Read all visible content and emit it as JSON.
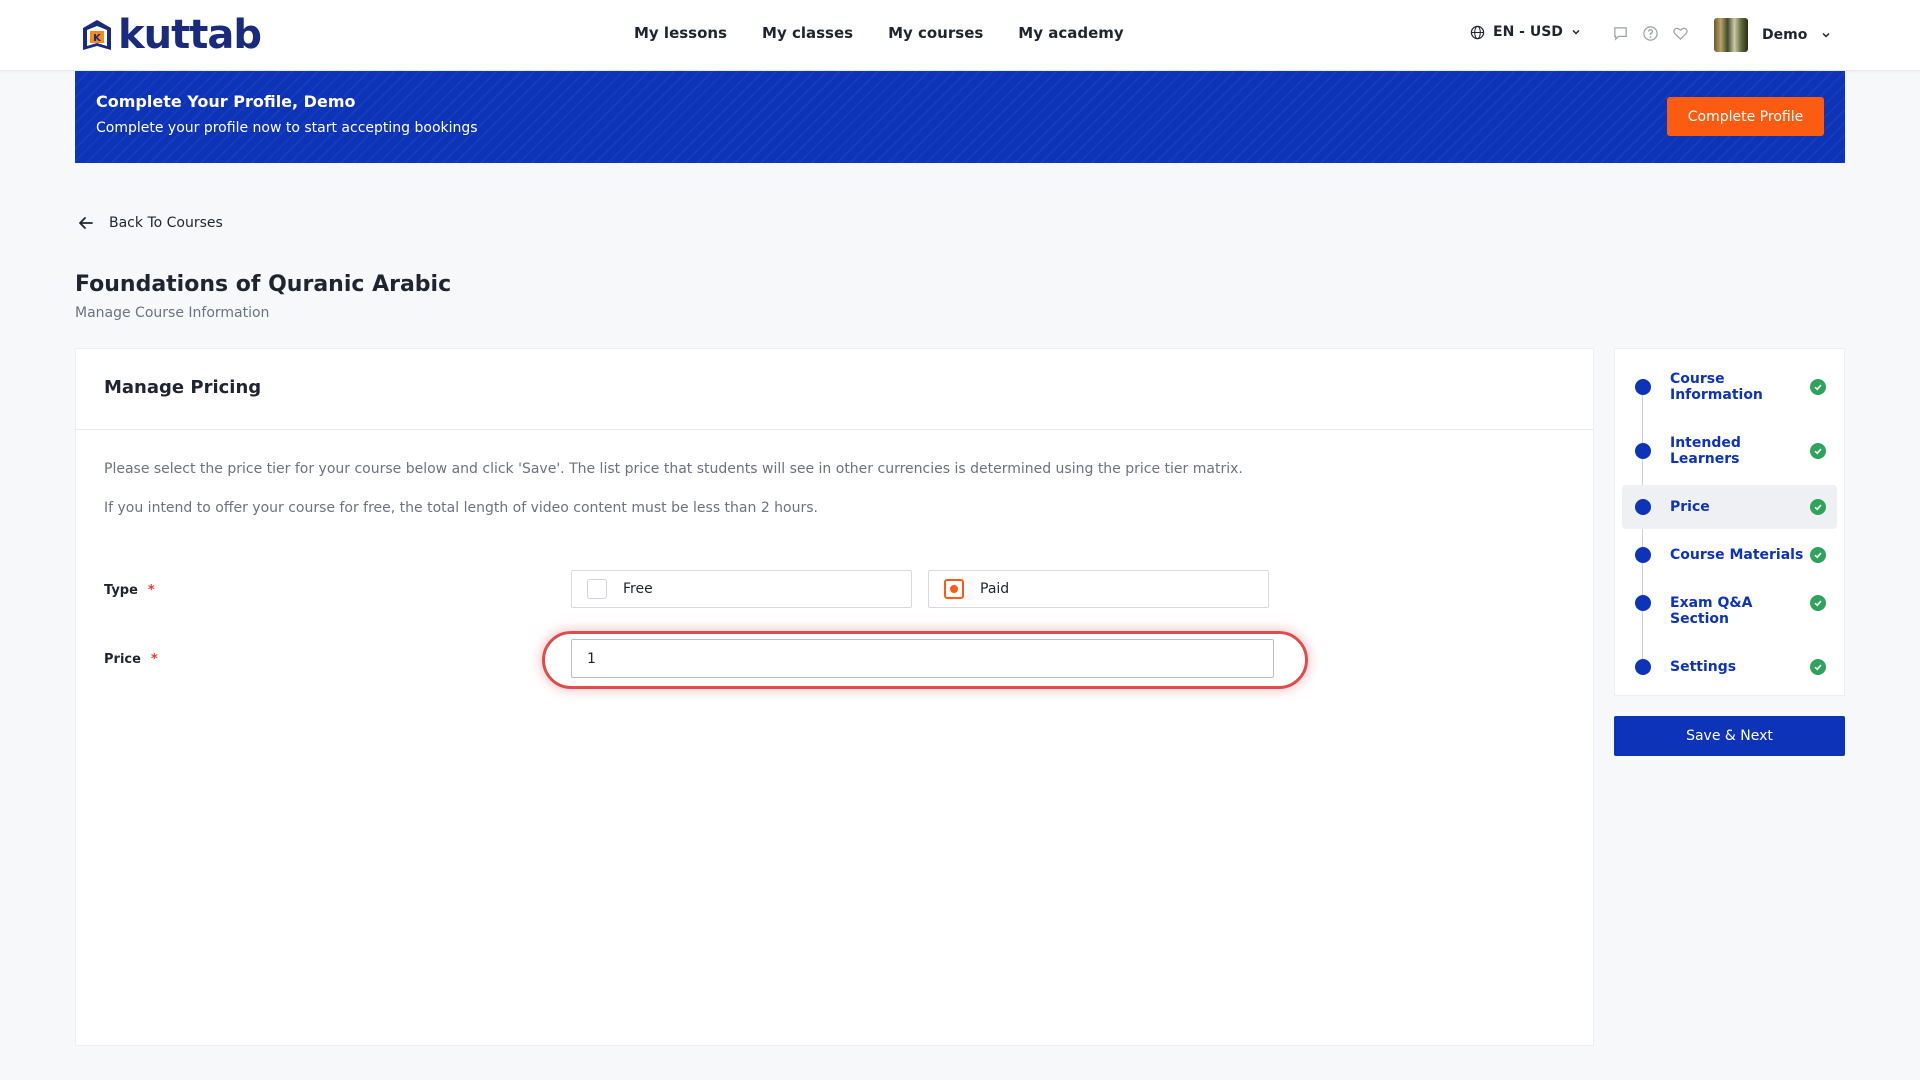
{
  "brand": {
    "name": "kuttab",
    "accent": "#0d33b8",
    "orange": "#fc5b12"
  },
  "nav": {
    "items": [
      "My lessons",
      "My classes",
      "My courses",
      "My academy"
    ]
  },
  "header": {
    "language": "EN - USD",
    "icons": [
      "chat-icon",
      "help-icon",
      "heart-icon"
    ],
    "user_name": "Demo"
  },
  "banner": {
    "title": "Complete Your Profile, Demo",
    "subtitle": "Complete your profile now to start accepting bookings",
    "button": "Complete Profile"
  },
  "back_link": "Back To Courses",
  "page": {
    "title": "Foundations of Quranic Arabic",
    "subtitle": "Manage Course Information"
  },
  "pricing": {
    "title": "Manage Pricing",
    "desc1": "Please select the price tier for your course below and click 'Save'. The list price that students will see in other currencies is determined using the price tier matrix.",
    "desc2": "If you intend to offer your course for free, the total length of video content must be less than 2 hours.",
    "type_label": "Type",
    "price_label": "Price",
    "required_mark": "*",
    "options": [
      {
        "label": "Free",
        "selected": false
      },
      {
        "label": "Paid",
        "selected": true
      }
    ],
    "price_value": "1"
  },
  "steps": [
    {
      "label": "Course Information",
      "done": true,
      "active": false
    },
    {
      "label": "Intended Learners",
      "done": true,
      "active": false
    },
    {
      "label": "Price",
      "done": true,
      "active": true
    },
    {
      "label": "Course Materials",
      "done": true,
      "active": false
    },
    {
      "label": "Exam Q&A Section",
      "done": true,
      "active": false
    },
    {
      "label": "Settings",
      "done": true,
      "active": false
    }
  ],
  "save_button": "Save & Next"
}
